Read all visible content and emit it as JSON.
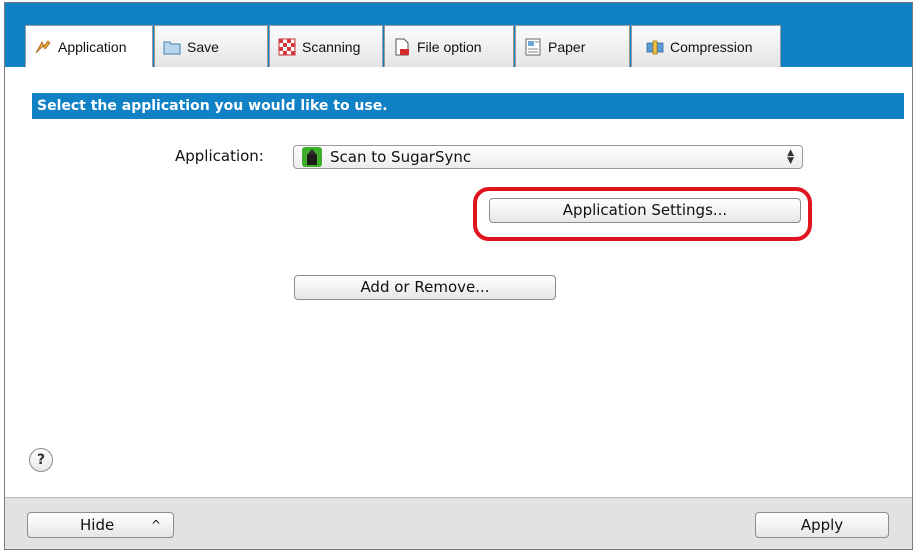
{
  "tabs": [
    {
      "label": "Application",
      "icon": "application-icon",
      "active": true
    },
    {
      "label": "Save",
      "icon": "folder-icon",
      "active": false
    },
    {
      "label": "Scanning",
      "icon": "scanning-icon",
      "active": false
    },
    {
      "label": "File option",
      "icon": "file-icon",
      "active": false
    },
    {
      "label": "Paper",
      "icon": "paper-icon",
      "active": false
    },
    {
      "label": "Compression",
      "icon": "compression-icon",
      "active": false
    }
  ],
  "main": {
    "banner": "Select the application you would like to use.",
    "application_label": "Application:",
    "application_selected": "Scan to SugarSync",
    "application_settings_label": "Application Settings...",
    "add_remove_label": "Add or Remove...",
    "help_label": "?"
  },
  "footer": {
    "hide_label": "Hide",
    "apply_label": "Apply"
  },
  "colors": {
    "accent": "#1081c4",
    "highlight": "#e0141e",
    "footer_bg": "#e2e2e2"
  }
}
